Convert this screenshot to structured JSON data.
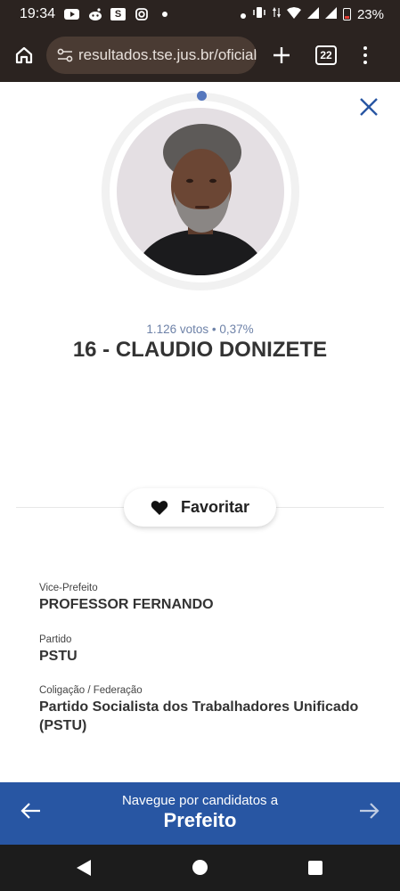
{
  "status_bar": {
    "time": "19:34",
    "battery": "23%",
    "left_icons": [
      "youtube-icon",
      "reddit-icon",
      "s-app-icon",
      "instagram-icon",
      "dot-icon"
    ],
    "right_icons": [
      "dot-icon",
      "vibrate-icon",
      "data-arrows-icon",
      "wifi-icon",
      "signal-icon",
      "signal-icon",
      "battery-icon"
    ]
  },
  "browser": {
    "url": "resultados.tse.jus.br/oficial",
    "tab_count": "22"
  },
  "candidate": {
    "votes_line": "1.126 votos • 0,37%",
    "name": "16 - CLAUDIO DONIZETE"
  },
  "favorite": {
    "label": "Favoritar"
  },
  "details": {
    "vice_label": "Vice-Prefeito",
    "vice_value": "PROFESSOR FERNANDO",
    "party_label": "Partido",
    "party_value": "PSTU",
    "coalition_label": "Coligação / Federação",
    "coalition_value": "Partido Socialista dos Trabalhadores Unificado (PSTU)"
  },
  "bottom_nav": {
    "subtitle": "Navegue por candidatos a",
    "title": "Prefeito"
  },
  "colors": {
    "accent_blue": "#2856a3",
    "votes_text": "#6e82a8",
    "ring_dot": "#5577bd"
  }
}
